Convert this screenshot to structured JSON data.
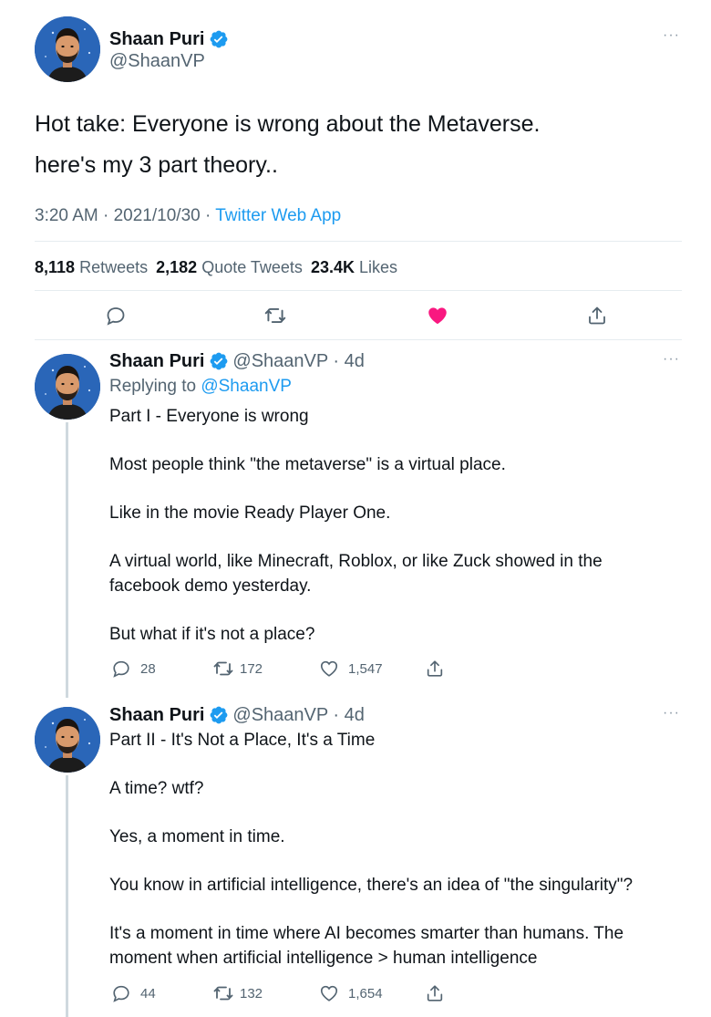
{
  "main_tweet": {
    "name": "Shaan Puri",
    "handle": "@ShaanVP",
    "more": "···",
    "text_line1": "Hot take: Everyone is wrong about the Metaverse.",
    "text_line2": "here's my 3 part theory..",
    "time": "3:20 AM",
    "date": "2021/10/30",
    "source": "Twitter Web App",
    "retweets_count": "8,118",
    "retweets_label": "Retweets",
    "quotes_count": "2,182",
    "quotes_label": "Quote Tweets",
    "likes_count": "23.4K",
    "likes_label": "Likes"
  },
  "replies": [
    {
      "name": "Shaan Puri",
      "handle": "@ShaanVP",
      "time": "4d",
      "replying_label": "Replying to",
      "replying_to": "@ShaanVP",
      "text": "Part I - Everyone is wrong\n\nMost people think \"the metaverse\" is a virtual place.\n\nLike in the movie Ready Player One.\n\nA virtual world, like Minecraft, Roblox, or like Zuck showed in the\nfacebook demo yesterday.\n\nBut what if it's not a place?",
      "replies": "28",
      "retweets": "172",
      "likes": "1,547"
    },
    {
      "name": "Shaan Puri",
      "handle": "@ShaanVP",
      "time": "4d",
      "text": "Part II - It's Not a Place, It's a Time\n\nA time? wtf?\n\nYes, a moment in time.\n\nYou know in artificial intelligence, there's an idea of \"the singularity\"?\n\nIt's a moment in time where AI becomes smarter than humans. The\nmoment when artificial intelligence > human intelligence",
      "replies": "44",
      "retweets": "132",
      "likes": "1,654"
    }
  ],
  "icons": {
    "verified": "verified-badge-icon",
    "reply": "speech-bubble-icon",
    "retweet": "retweet-arrows-icon",
    "like": "heart-icon",
    "share": "share-upload-icon"
  },
  "colors": {
    "link": "#1d9bf0",
    "like_active": "#f91880",
    "text": "#0f1419",
    "secondary": "#536471"
  }
}
